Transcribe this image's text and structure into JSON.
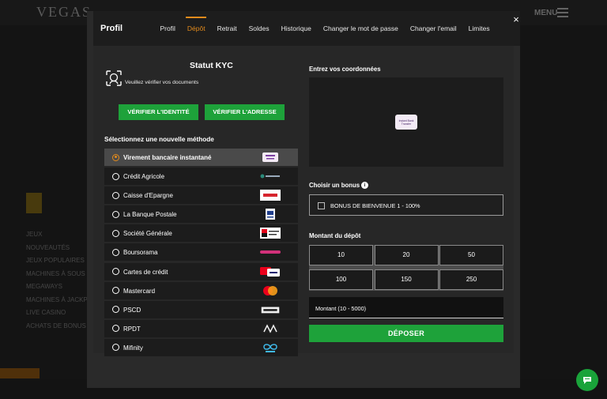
{
  "background": {
    "logo": "VEGAS",
    "menu_label": "MENU",
    "nav_items": [
      "Jeux",
      "Nouveautés",
      "Jeux populaires",
      "Machines à sous",
      "Megaways",
      "Machines à jackpot",
      "Live Casino",
      "Achats de bonus"
    ]
  },
  "modal": {
    "title": "Profil",
    "tabs": [
      "Profil",
      "Dépôt",
      "Retrait",
      "Soldes",
      "Historique",
      "Changer le mot de passe",
      "Changer l'email",
      "Limites"
    ],
    "active_tab": "Dépôt",
    "close_label": "×"
  },
  "kyc": {
    "title": "Statut KYC",
    "message": "Veuillez vérifier vos documents",
    "verify_identity_label": "Vérifier l'identité",
    "verify_address_label": "Vérifier l'adresse"
  },
  "methods": {
    "title": "Sélectionnez une nouvelle méthode",
    "items": [
      {
        "label": "Virement bancaire instantané",
        "icon": "instant-bank-transfer-logo",
        "selected": true
      },
      {
        "label": "Crédit Agricole",
        "icon": "credit-agricole-logo",
        "selected": false
      },
      {
        "label": "Caisse d'Epargne",
        "icon": "caisse-epargne-logo",
        "selected": false
      },
      {
        "label": "La Banque Postale",
        "icon": "banque-postale-logo",
        "selected": false
      },
      {
        "label": "Société Générale",
        "icon": "societe-generale-logo",
        "selected": false
      },
      {
        "label": "Boursorama",
        "icon": "boursorama-logo",
        "selected": false
      },
      {
        "label": "Cartes de crédit",
        "icon": "credit-cards-logo",
        "selected": false
      },
      {
        "label": "Mastercard",
        "icon": "mastercard-logo",
        "selected": false
      },
      {
        "label": "PSCD",
        "icon": "pscd-logo",
        "selected": false
      },
      {
        "label": "RPDT",
        "icon": "rpdt-logo",
        "selected": false
      },
      {
        "label": "Mifinity",
        "icon": "mifinity-logo",
        "selected": false
      }
    ]
  },
  "coordinates": {
    "title": "Entrez vos coordonnées",
    "badge_text": "Instant Bank Transfer"
  },
  "bonus": {
    "title": "Choisir un bonus",
    "option_label": "BONUS DE BIENVENUE 1 - 100%",
    "checked": false
  },
  "amount": {
    "title": "Montant du dépôt",
    "presets": [
      "10",
      "20",
      "50",
      "100",
      "150",
      "250"
    ],
    "input_placeholder": "Montant (10 - 5000)"
  },
  "deposit_label": "Déposer",
  "colors": {
    "accent": "#e38b1c",
    "green": "#1ea23a",
    "modal_bg": "#2a2a2a"
  }
}
